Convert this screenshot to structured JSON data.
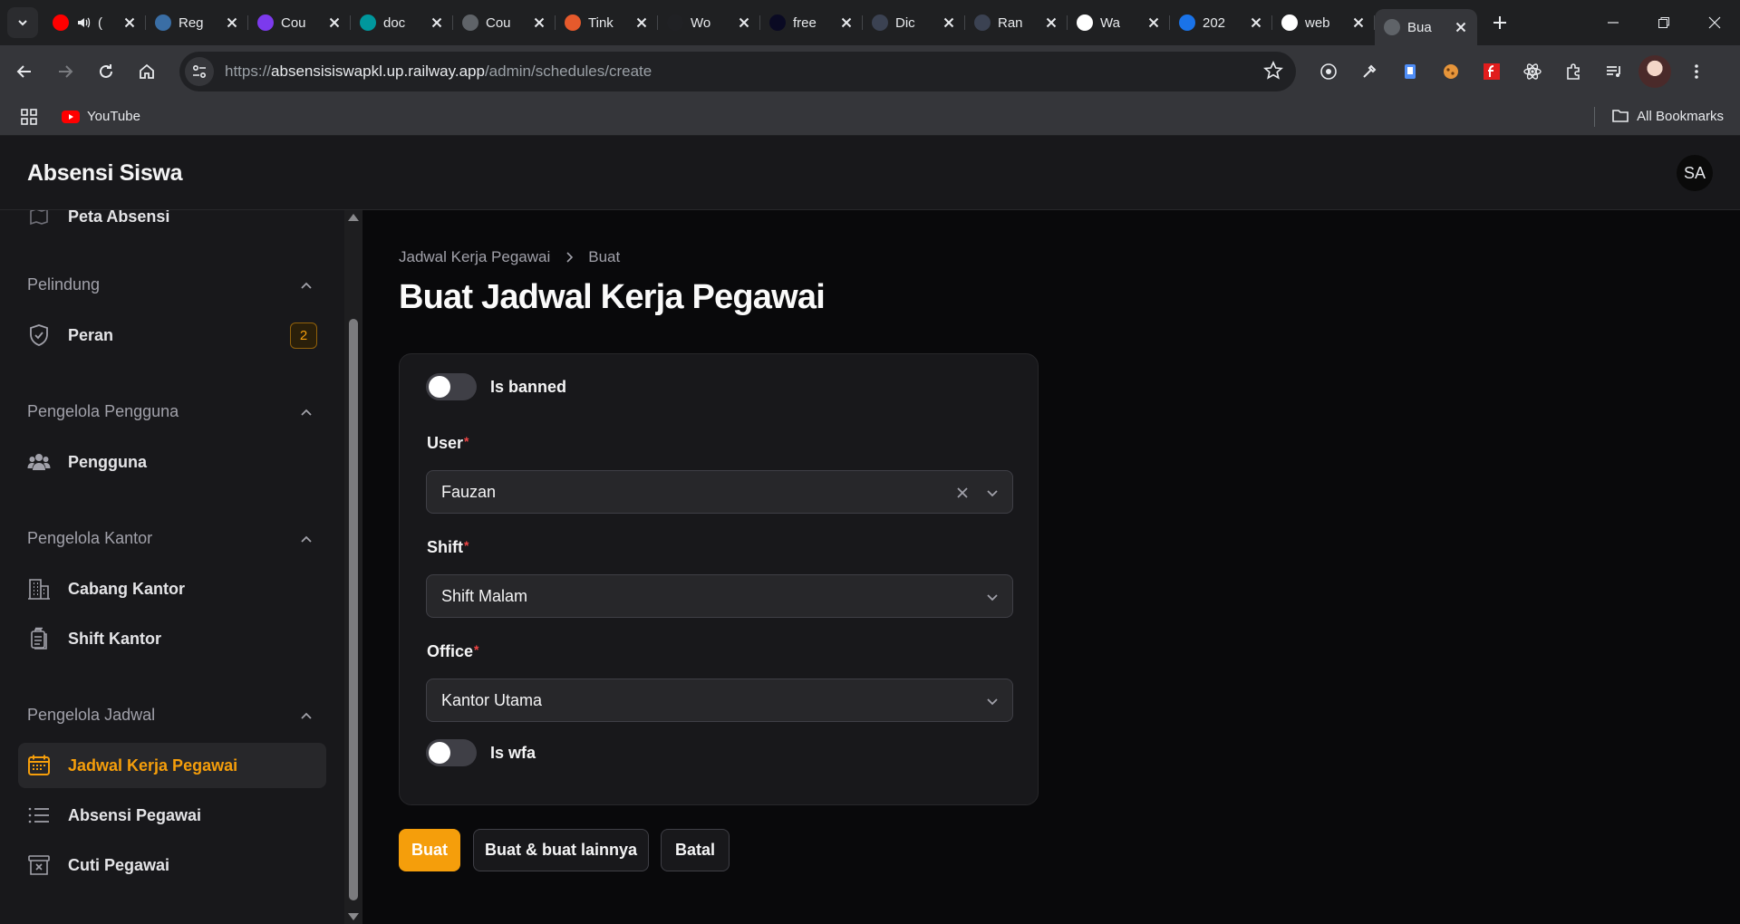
{
  "browser": {
    "tabs": [
      {
        "title": "(",
        "icon": "youtube-favicon",
        "color": "#ff0000",
        "muted": true
      },
      {
        "title": "Reg",
        "icon": "reg-favicon",
        "color": "#3a6ea5"
      },
      {
        "title": "Cou",
        "icon": "u-favicon",
        "color": "#7c3aed"
      },
      {
        "title": "doc",
        "icon": "arduino-favicon",
        "color": "#00979d"
      },
      {
        "title": "Cou",
        "icon": "globe-favicon",
        "color": "#5f6368"
      },
      {
        "title": "Tink",
        "icon": "tinkercad-favicon",
        "color": "#e65a2c"
      },
      {
        "title": "Wo",
        "icon": "wordwall-favicon",
        "color": "#202124"
      },
      {
        "title": "free",
        "icon": "freecodecamp-favicon",
        "color": "#0a0a23"
      },
      {
        "title": "Dic",
        "icon": "g-favicon",
        "color": "#3b4252"
      },
      {
        "title": "Ran",
        "icon": "g-favicon",
        "color": "#3b4252"
      },
      {
        "title": "Wa",
        "icon": "openai-favicon",
        "color": "#ffffff"
      },
      {
        "title": "202",
        "icon": "bulb-favicon",
        "color": "#1a73e8"
      },
      {
        "title": "web",
        "icon": "web-favicon",
        "color": "#ffffff"
      },
      {
        "title": "Bua",
        "icon": "globe-favicon",
        "color": "#5f6368",
        "active": true
      }
    ],
    "url_scheme": "https://",
    "url_host": "absensisiswapkl.up.railway.app",
    "url_path": "/admin/schedules/create",
    "bookmarks": [
      {
        "label": "YouTube",
        "icon": "youtube-icon"
      }
    ],
    "all_bookmarks_label": "All Bookmarks"
  },
  "app": {
    "brand": "Absensi Siswa",
    "user_initials": "SA"
  },
  "sidebar": {
    "partial_item": "Peta Absensi",
    "groups": [
      {
        "label": "Pelindung",
        "items": [
          {
            "label": "Peran",
            "icon": "shield-check-icon",
            "badge": "2"
          }
        ]
      },
      {
        "label": "Pengelola Pengguna",
        "items": [
          {
            "label": "Pengguna",
            "icon": "users-icon"
          }
        ]
      },
      {
        "label": "Pengelola Kantor",
        "items": [
          {
            "label": "Cabang Kantor",
            "icon": "building-icon"
          },
          {
            "label": "Shift Kantor",
            "icon": "clipboard-icon"
          }
        ]
      },
      {
        "label": "Pengelola Jadwal",
        "items": [
          {
            "label": "Jadwal Kerja Pegawai",
            "icon": "calendar-icon",
            "active": true
          },
          {
            "label": "Absensi Pegawai",
            "icon": "list-icon"
          },
          {
            "label": "Cuti Pegawai",
            "icon": "archive-x-icon"
          }
        ]
      }
    ]
  },
  "page": {
    "breadcrumb": [
      "Jadwal Kerja Pegawai",
      "Buat"
    ],
    "title": "Buat Jadwal Kerja Pegawai"
  },
  "form": {
    "is_banned": {
      "label": "Is banned",
      "on": false
    },
    "user": {
      "label": "User",
      "value": "Fauzan"
    },
    "shift": {
      "label": "Shift",
      "value": "Shift Malam"
    },
    "office": {
      "label": "Office",
      "value": "Kantor Utama"
    },
    "is_wfa": {
      "label": "Is wfa",
      "on": false
    }
  },
  "actions": {
    "create": "Buat",
    "create_another": "Buat & buat lainnya",
    "cancel": "Batal"
  },
  "colors": {
    "accent": "#f59e0b",
    "danger": "#ef4444"
  }
}
